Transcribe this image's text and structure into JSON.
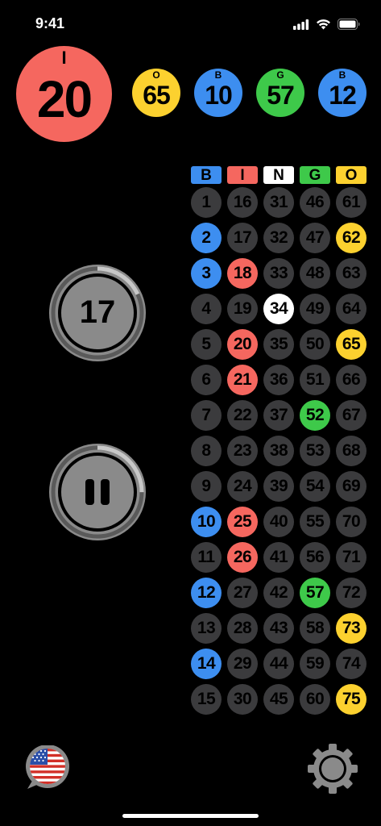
{
  "status": {
    "time": "9:41"
  },
  "colors": {
    "B": "#3d8ef0",
    "I": "#f5675f",
    "N": "#ffffff",
    "G": "#3ec94a",
    "O": "#fcd12f",
    "uncalled": "#3b3b3d"
  },
  "current_ball": {
    "letter": "I",
    "number": "20"
  },
  "recent_balls": [
    {
      "letter": "O",
      "number": "65"
    },
    {
      "letter": "B",
      "number": "10"
    },
    {
      "letter": "G",
      "number": "57"
    },
    {
      "letter": "B",
      "number": "12"
    }
  ],
  "timer": {
    "value": "17",
    "progress": 0.18
  },
  "pause": {
    "progress": 0.25
  },
  "board": {
    "headers": [
      "B",
      "I",
      "N",
      "G",
      "O"
    ],
    "columns": [
      [
        "1",
        "2",
        "3",
        "4",
        "5",
        "6",
        "7",
        "8",
        "9",
        "10",
        "11",
        "12",
        "13",
        "14",
        "15"
      ],
      [
        "16",
        "17",
        "18",
        "19",
        "20",
        "21",
        "22",
        "23",
        "24",
        "25",
        "26",
        "27",
        "28",
        "29",
        "30"
      ],
      [
        "31",
        "32",
        "33",
        "34",
        "35",
        "36",
        "37",
        "38",
        "39",
        "40",
        "41",
        "42",
        "43",
        "44",
        "45"
      ],
      [
        "46",
        "47",
        "48",
        "49",
        "50",
        "51",
        "52",
        "53",
        "54",
        "55",
        "56",
        "57",
        "58",
        "59",
        "60"
      ],
      [
        "61",
        "62",
        "63",
        "64",
        "65",
        "66",
        "67",
        "68",
        "69",
        "70",
        "71",
        "72",
        "73",
        "74",
        "75"
      ]
    ],
    "called": [
      "2",
      "3",
      "10",
      "12",
      "14",
      "18",
      "20",
      "21",
      "25",
      "26",
      "34",
      "52",
      "57",
      "62",
      "65",
      "73",
      "75"
    ]
  },
  "icons": {
    "signal": "cellular-signal-icon",
    "wifi": "wifi-icon",
    "battery": "battery-icon",
    "language": "us-flag-icon",
    "settings": "gear-icon"
  }
}
